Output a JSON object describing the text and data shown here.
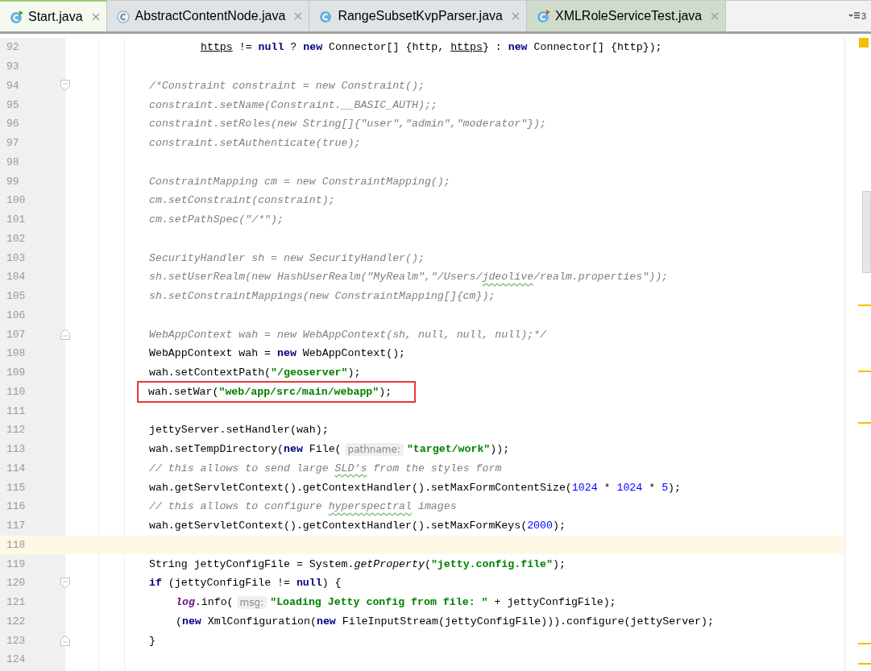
{
  "tabs": [
    {
      "label": "Start.java",
      "selected": true,
      "kind": "runnable",
      "color": "#f5faf0"
    },
    {
      "label": "AbstractContentNode.java",
      "selected": false,
      "kind": "abstract",
      "color": "#dfe3e6"
    },
    {
      "label": "RangeSubsetKvpParser.java",
      "selected": false,
      "kind": "class",
      "color": "#dfe3e6"
    },
    {
      "label": "XMLRoleServiceTest.java",
      "selected": false,
      "kind": "test",
      "color": "#cfdccb"
    }
  ],
  "tab_overflow": {
    "count": "3"
  },
  "editor": {
    "lines": [
      {
        "number": "92",
        "kind": "continuation",
        "tokens": [
          {
            "t": "https",
            "kind": "link"
          },
          {
            "t": " != ",
            "kind": "plain"
          },
          {
            "t": "null",
            "kind": "kw"
          },
          {
            "t": " ? ",
            "kind": "plain"
          },
          {
            "t": "new",
            "kind": "kw"
          },
          {
            "t": " Connector[] {http, ",
            "kind": "plain"
          },
          {
            "t": "https",
            "kind": "link"
          },
          {
            "t": "} : ",
            "kind": "plain"
          },
          {
            "t": "new",
            "kind": "kw"
          },
          {
            "t": " Connector[] {http});",
            "kind": "plain"
          }
        ]
      },
      {
        "number": "93",
        "kind": "code"
      },
      {
        "number": "94",
        "kind": "fold-start",
        "tokens": [
          {
            "t": "/*Constraint constraint = new Constraint();",
            "kind": "comment"
          }
        ]
      },
      {
        "number": "95",
        "kind": "code",
        "tokens": [
          {
            "t": "constraint.setName(Constraint.__BASIC_AUTH);;",
            "kind": "comment"
          }
        ]
      },
      {
        "number": "96",
        "kind": "code",
        "tokens": [
          {
            "t": "constraint.setRoles(new String[]{\"user\",\"admin\",\"moderator\"});",
            "kind": "comment"
          }
        ]
      },
      {
        "number": "97",
        "kind": "code",
        "tokens": [
          {
            "t": "constraint.setAuthenticate(true);",
            "kind": "comment"
          }
        ]
      },
      {
        "number": "98",
        "kind": "code"
      },
      {
        "number": "99",
        "kind": "code",
        "tokens": [
          {
            "t": "ConstraintMapping cm = new ConstraintMapping();",
            "kind": "comment"
          }
        ]
      },
      {
        "number": "100",
        "kind": "code",
        "tokens": [
          {
            "t": "cm.setConstraint(constraint);",
            "kind": "comment"
          }
        ]
      },
      {
        "number": "101",
        "kind": "code",
        "tokens": [
          {
            "t": "cm.setPathSpec(\"/*\");",
            "kind": "comment"
          }
        ]
      },
      {
        "number": "102",
        "kind": "code"
      },
      {
        "number": "103",
        "kind": "code",
        "tokens": [
          {
            "t": "SecurityHandler sh = new SecurityHandler();",
            "kind": "comment"
          }
        ]
      },
      {
        "number": "104",
        "kind": "code",
        "tokens": [
          {
            "t": "sh.setUserRealm(new HashUserRealm(\"MyRealm\",\"/Users/",
            "kind": "comment"
          },
          {
            "t": "jdeolive",
            "kind": "typo"
          },
          {
            "t": "/realm.properties\"));",
            "kind": "comment"
          }
        ]
      },
      {
        "number": "105",
        "kind": "code",
        "tokens": [
          {
            "t": "sh.setConstraintMappings(new ConstraintMapping[]{cm});",
            "kind": "comment"
          }
        ]
      },
      {
        "number": "106",
        "kind": "code"
      },
      {
        "number": "107",
        "kind": "fold-end",
        "tokens": [
          {
            "t": "WebAppContext wah = new WebAppContext(sh, null, null, null);*/",
            "kind": "comment"
          }
        ]
      },
      {
        "number": "108",
        "kind": "code",
        "tokens": [
          {
            "t": "WebAppContext wah = ",
            "kind": "plain"
          },
          {
            "t": "new",
            "kind": "kw"
          },
          {
            "t": " WebAppContext();",
            "kind": "plain"
          }
        ]
      },
      {
        "number": "109",
        "kind": "code",
        "tokens": [
          {
            "t": "wah.setContextPath(",
            "kind": "plain"
          },
          {
            "t": "\"/geoserver\"",
            "kind": "str"
          },
          {
            "t": ");",
            "kind": "plain"
          }
        ]
      },
      {
        "number": "110",
        "kind": "code",
        "boxed": true,
        "tokens": [
          {
            "t": "wah.setWar(",
            "kind": "plain"
          },
          {
            "t": "\"web/app/src/main/webapp\"",
            "kind": "str"
          },
          {
            "t": ");",
            "kind": "plain"
          }
        ]
      },
      {
        "number": "111",
        "kind": "code"
      },
      {
        "number": "112",
        "kind": "code",
        "tokens": [
          {
            "t": "jettyServer.setHandler(wah);",
            "kind": "plain"
          }
        ]
      },
      {
        "number": "113",
        "kind": "code",
        "tokens": [
          {
            "t": "wah.setTempDirectory(",
            "kind": "plain"
          },
          {
            "t": "new",
            "kind": "kw"
          },
          {
            "t": " File(",
            "kind": "plain"
          },
          {
            "t": "pathname:",
            "kind": "hint"
          },
          {
            "t": "\"target/work\"",
            "kind": "str"
          },
          {
            "t": "));",
            "kind": "plain"
          }
        ]
      },
      {
        "number": "114",
        "kind": "code",
        "tokens": [
          {
            "t": "// this allows to send large ",
            "kind": "comment"
          },
          {
            "t": "SLD's",
            "kind": "typo"
          },
          {
            "t": " from the styles form",
            "kind": "comment"
          }
        ]
      },
      {
        "number": "115",
        "kind": "code",
        "tokens": [
          {
            "t": "wah.getServletContext().getContextHandler().setMaxFormContentSize(",
            "kind": "plain"
          },
          {
            "t": "1024",
            "kind": "num"
          },
          {
            "t": " * ",
            "kind": "plain"
          },
          {
            "t": "1024",
            "kind": "num"
          },
          {
            "t": " * ",
            "kind": "plain"
          },
          {
            "t": "5",
            "kind": "num"
          },
          {
            "t": ");",
            "kind": "plain"
          }
        ]
      },
      {
        "number": "116",
        "kind": "code",
        "tokens": [
          {
            "t": "// this allows to configure ",
            "kind": "comment"
          },
          {
            "t": "hyperspectral",
            "kind": "typo"
          },
          {
            "t": " images",
            "kind": "comment"
          }
        ]
      },
      {
        "number": "117",
        "kind": "code",
        "tokens": [
          {
            "t": "wah.getServletContext().getContextHandler().setMaxFormKeys(",
            "kind": "plain"
          },
          {
            "t": "2000",
            "kind": "num"
          },
          {
            "t": ");",
            "kind": "plain"
          }
        ]
      },
      {
        "number": "118",
        "kind": "code",
        "current": true
      },
      {
        "number": "119",
        "kind": "code",
        "tokens": [
          {
            "t": "String jettyConfigFile = System.",
            "kind": "plain"
          },
          {
            "t": "getProperty",
            "kind": "static"
          },
          {
            "t": "(",
            "kind": "plain"
          },
          {
            "t": "\"jetty.config.file\"",
            "kind": "str"
          },
          {
            "t": ");",
            "kind": "plain"
          }
        ]
      },
      {
        "number": "120",
        "kind": "fold-start",
        "tokens": [
          {
            "t": "if",
            "kind": "kw"
          },
          {
            "t": " (jettyConfigFile != ",
            "kind": "plain"
          },
          {
            "t": "null",
            "kind": "kw"
          },
          {
            "t": ") {",
            "kind": "plain"
          }
        ],
        "children": [
          {
            "number": "121",
            "kind": "code",
            "tokens": [
              {
                "t": "log",
                "kind": "field"
              },
              {
                "t": ".info(",
                "kind": "plain"
              },
              {
                "t": "msg:",
                "kind": "hint"
              },
              {
                "t": "\"Loading Jetty config from file: \"",
                "kind": "str"
              },
              {
                "t": " + jettyConfigFile);",
                "kind": "plain"
              }
            ]
          },
          {
            "number": "122",
            "kind": "code",
            "tokens": [
              {
                "t": "(",
                "kind": "plain"
              },
              {
                "t": "new",
                "kind": "kw"
              },
              {
                "t": " XmlConfiguration(",
                "kind": "plain"
              },
              {
                "t": "new",
                "kind": "kw"
              },
              {
                "t": " FileInputStream(jettyConfigFile))).configure(jettyServer);",
                "kind": "plain"
              }
            ]
          }
        ]
      },
      {
        "number": "123",
        "kind": "fold-end",
        "tokens": [
          {
            "t": "}",
            "kind": "plain"
          }
        ]
      },
      {
        "number": "124",
        "kind": "code"
      }
    ]
  }
}
